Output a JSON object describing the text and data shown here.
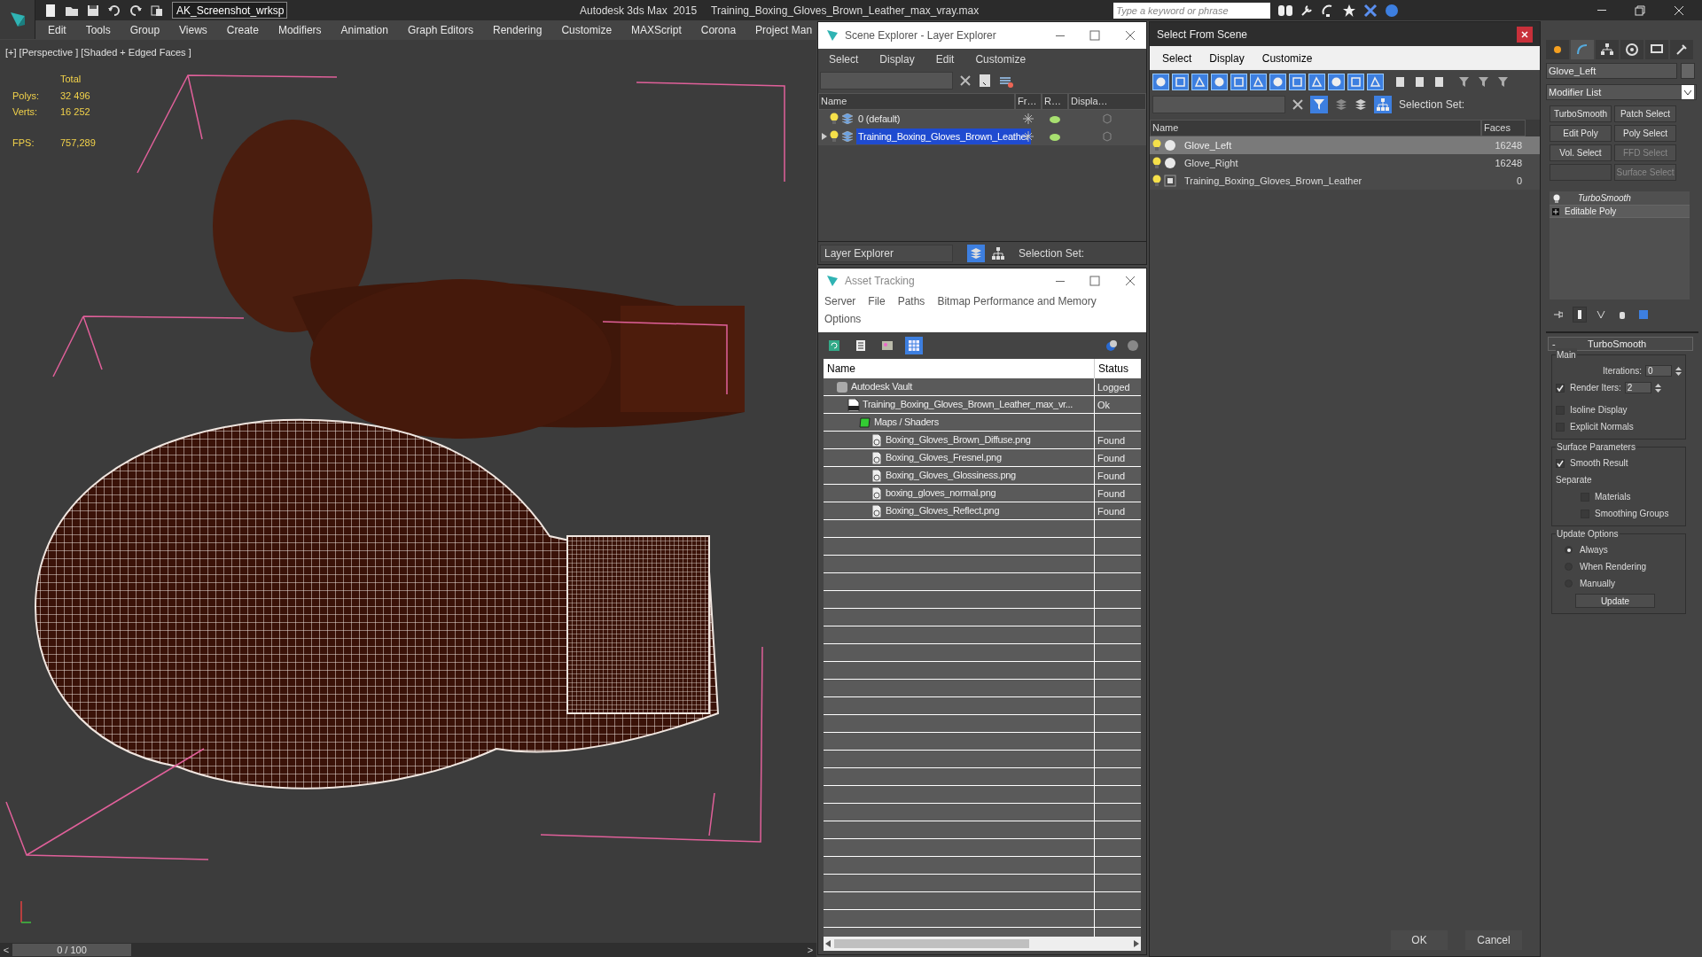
{
  "app_bar": {
    "workspace": "AK_Screenshot_wrksp",
    "product": "Autodesk 3ds Max  2015",
    "file": "Training_Boxing_Gloves_Brown_Leather_max_vray.max",
    "search": {
      "placeholder": "Type a keyword or phrase"
    }
  },
  "menu_bar": [
    "Edit",
    "Tools",
    "Group",
    "Views",
    "Create",
    "Modifiers",
    "Animation",
    "Graph Editors",
    "Rendering",
    "Customize",
    "MAXScript",
    "Corona",
    "Project Man"
  ],
  "viewport": {
    "label": "[+] [Perspective ] [Shaded + Edged Faces ]",
    "stats_header": "Total",
    "stats": [
      {
        "label": "Polys:",
        "value": "32 496"
      },
      {
        "label": "Verts:",
        "value": "16 252"
      },
      {
        "label": "FPS:",
        "value": "757,289"
      }
    ],
    "timeline": {
      "prev": "<",
      "frame": "0 / 100",
      "next": ">",
      "level": 0
    }
  },
  "scene_explorer": {
    "title": "Scene Explorer - Layer Explorer",
    "menu": [
      "Select",
      "Display",
      "Edit",
      "Customize"
    ],
    "columns": [
      "Name",
      "Fr…",
      "R…",
      "Displa…"
    ],
    "rows": [
      {
        "name": "0 (default)",
        "selected": false,
        "expandable": false
      },
      {
        "name": "Training_Boxing_Gloves_Brown_Leather",
        "selected": true,
        "expandable": true
      }
    ],
    "explorer_type": "Layer Explorer",
    "selection_set_label": "Selection Set:"
  },
  "asset_tracking": {
    "title": "Asset Tracking",
    "menu": [
      "Server",
      "File",
      "Paths",
      "Bitmap Performance and Memory",
      "Options"
    ],
    "columns": [
      "Name",
      "Status"
    ],
    "rows": [
      {
        "name": "Autodesk Vault",
        "status": "Logged",
        "kind": "vault",
        "children": [
          {
            "name": "Training_Boxing_Gloves_Brown_Leather_max_vr...",
            "status": "Ok",
            "kind": "max",
            "children": [
              {
                "name": "Maps / Shaders",
                "kind": "folder",
                "children": [
                  {
                    "name": "Boxing_Gloves_Brown_Diffuse.png",
                    "status": "Found",
                    "kind": "bitmap"
                  },
                  {
                    "name": "Boxing_Gloves_Fresnel.png",
                    "status": "Found",
                    "kind": "bitmap"
                  },
                  {
                    "name": "Boxing_Gloves_Glossiness.png",
                    "status": "Found",
                    "kind": "bitmap"
                  },
                  {
                    "name": "boxing_gloves_normal.png",
                    "status": "Found",
                    "kind": "bitmap"
                  },
                  {
                    "name": "Boxing_Gloves_Reflect.png",
                    "status": "Found",
                    "kind": "bitmap"
                  }
                ]
              }
            ]
          }
        ]
      }
    ]
  },
  "select_from_scene": {
    "title": "Select From Scene",
    "menu": [
      "Select",
      "Display",
      "Customize"
    ],
    "selection_set_label": "Selection Set:",
    "columns": [
      "Name",
      "Faces"
    ],
    "rows": [
      {
        "name": "Glove_Left",
        "faces": "16248",
        "selected": true,
        "kind": "geometry"
      },
      {
        "name": "Glove_Right",
        "faces": "16248",
        "selected": false,
        "kind": "geometry"
      },
      {
        "name": "Training_Boxing_Gloves_Brown_Leather",
        "faces": "0",
        "selected": false,
        "kind": "group"
      }
    ],
    "buttons": [
      "OK",
      "Cancel"
    ]
  },
  "command_panel": {
    "object_name": "Glove_Left",
    "modifier_list": "Modifier List",
    "modifier_buttons": [
      {
        "kind": "labeled",
        "label": "TurboSmooth",
        "disabled": false
      },
      {
        "kind": "labeled",
        "label": "Patch Select",
        "disabled": false
      },
      {
        "kind": "labeled",
        "label": "Edit Poly",
        "disabled": false
      },
      {
        "kind": "labeled",
        "label": "Poly Select",
        "disabled": false
      },
      {
        "kind": "labeled",
        "label": "Vol. Select",
        "disabled": false
      },
      {
        "kind": "labeled",
        "label": "FFD Select",
        "disabled": true
      },
      {
        "kind": "blank"
      },
      {
        "kind": "labeled",
        "label": "Surface Select",
        "disabled": true
      }
    ],
    "stack": [
      {
        "name": "TurboSmooth",
        "kind": "modifier"
      },
      {
        "name": "Editable Poly",
        "kind": "base"
      }
    ],
    "rollout": {
      "collapse": "-",
      "title": "TurboSmooth",
      "main_label": "Main",
      "iterations": {
        "label": "Iterations:",
        "value": "0"
      },
      "render_iters": {
        "label": "Render Iters:",
        "value": "2",
        "checked": true
      },
      "main_checks": [
        {
          "label": "Isoline Display",
          "checked": false
        },
        {
          "label": "Explicit Normals",
          "checked": false
        }
      ],
      "surface_label": "Surface Parameters",
      "smooth_result": {
        "label": "Smooth Result",
        "checked": true
      },
      "separate_label": "Separate",
      "separate_checks": [
        {
          "label": "Materials",
          "checked": false
        },
        {
          "label": "Smoothing Groups",
          "checked": false
        }
      ],
      "update_label": "Update Options",
      "update_options": [
        {
          "label": "Always",
          "selected": true
        },
        {
          "label": "When Rendering",
          "selected": false
        },
        {
          "label": "Manually",
          "selected": false
        }
      ],
      "update_button": "Update"
    }
  }
}
